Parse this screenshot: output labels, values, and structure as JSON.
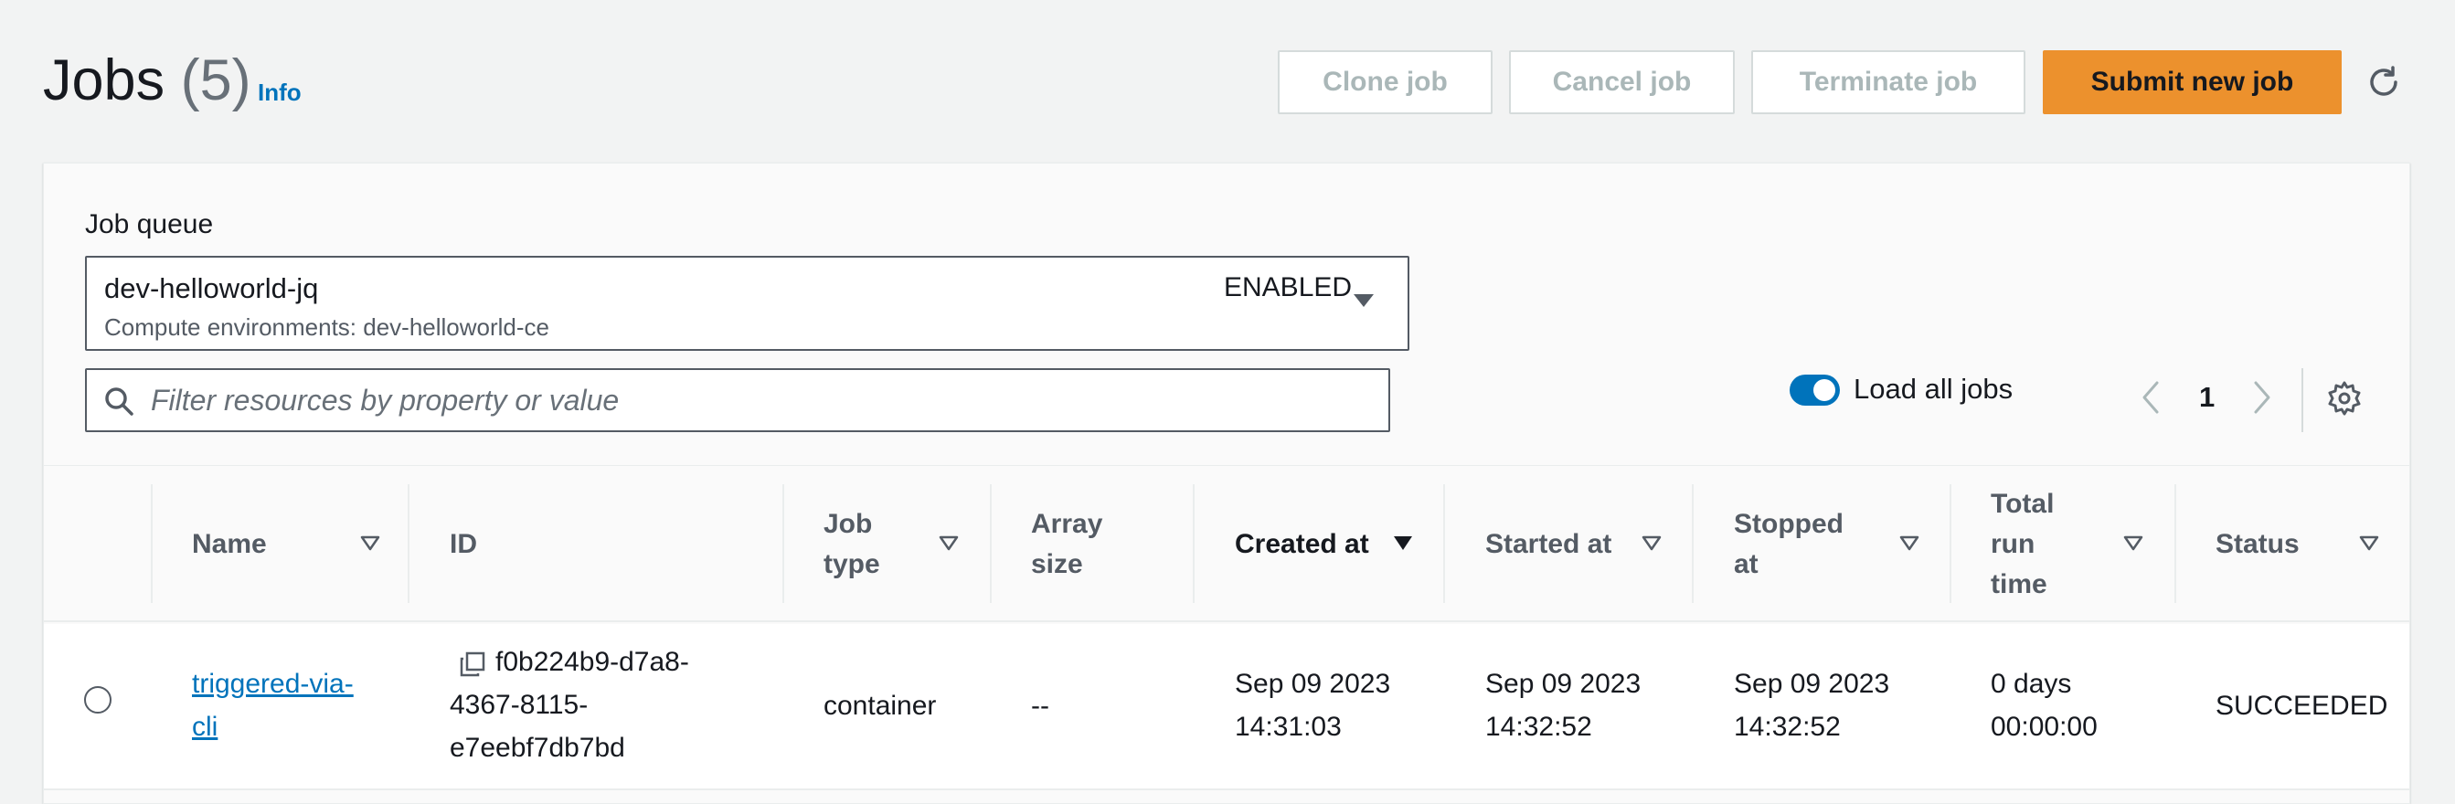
{
  "header": {
    "title": "Jobs",
    "count": "(5)",
    "info_link": "Info",
    "buttons": {
      "clone": "Clone job",
      "cancel": "Cancel job",
      "terminate": "Terminate job",
      "submit": "Submit new job"
    },
    "refresh_icon": "refresh-icon"
  },
  "filters": {
    "job_queue_label": "Job queue",
    "job_queue": {
      "name": "dev-helloworld-jq",
      "compute_env": "Compute environments: dev-helloworld-ce",
      "state": "ENABLED"
    },
    "search_placeholder": "Filter resources by property or value",
    "search_value": "",
    "load_all_jobs_label": "Load all jobs",
    "load_all_jobs_enabled": true
  },
  "pagination": {
    "current_page": "1"
  },
  "table": {
    "columns": [
      {
        "line1": "Name",
        "line2": "",
        "line3": ""
      },
      {
        "line1": "ID",
        "line2": "",
        "line3": ""
      },
      {
        "line1": "Job",
        "line2": "type",
        "line3": ""
      },
      {
        "line1": "Array",
        "line2": "size",
        "line3": ""
      },
      {
        "line1": "Created at",
        "line2": "",
        "line3": ""
      },
      {
        "line1": "Started at",
        "line2": "",
        "line3": ""
      },
      {
        "line1": "Stopped",
        "line2": "at",
        "line3": ""
      },
      {
        "line1": "Total",
        "line2": "run",
        "line3": "time"
      },
      {
        "line1": "Status",
        "line2": "",
        "line3": ""
      }
    ],
    "rows": [
      {
        "name_line1": "triggered-via-",
        "name_line2": "cli",
        "id_line1": "f0b224b9-d7a8-",
        "id_line2": "4367-8115-",
        "id_line3": "e7eebf7db7bd",
        "job_type": "container",
        "array_size": "--",
        "created_date": "Sep 09 2023",
        "created_time": "14:31:03",
        "started_date": "Sep 09 2023",
        "started_time": "14:32:52",
        "stopped_date": "Sep 09 2023",
        "stopped_time": "14:32:52",
        "run_time_line1": "0 days",
        "run_time_line2": "00:00:00",
        "status": "SUCCEEDED"
      }
    ]
  },
  "colors": {
    "accent": "#ec912d",
    "link": "#0073bb",
    "background": "#f2f3f3"
  }
}
